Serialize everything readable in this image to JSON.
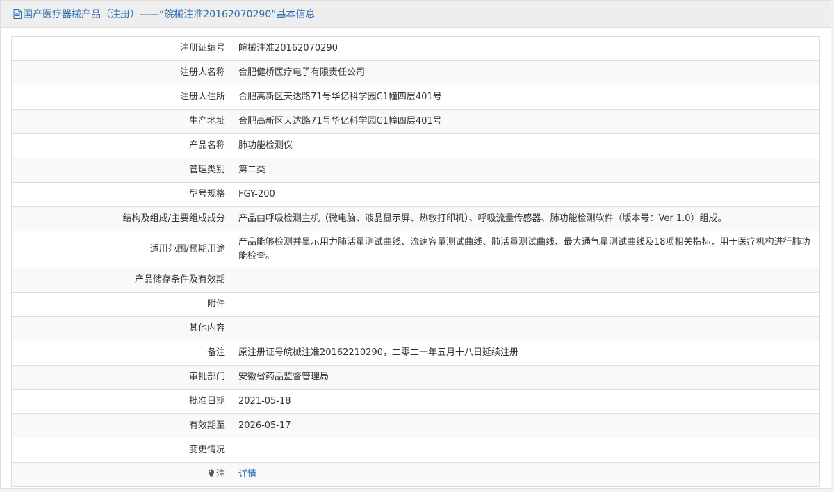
{
  "header": {
    "title": "国产医疗器械产品（注册）——“皖械注准20162070290”基本信息"
  },
  "rows": [
    {
      "label": "注册证编号",
      "value": "皖械注准20162070290"
    },
    {
      "label": "注册人名称",
      "value": "合肥健桥医疗电子有限责任公司"
    },
    {
      "label": "注册人住所",
      "value": "合肥高新区天达路71号华亿科学园C1幢四层401号"
    },
    {
      "label": "生产地址",
      "value": "合肥高新区天达路71号华亿科学园C1幢四层401号"
    },
    {
      "label": "产品名称",
      "value": "肺功能检测仪"
    },
    {
      "label": "管理类别",
      "value": "第二类"
    },
    {
      "label": "型号规格",
      "value": "FGY-200"
    },
    {
      "label": "结构及组成/主要组成成分",
      "value": "产品由呼吸检测主机（微电脑、液晶显示屏、热敏打印机）、呼吸流量传感器、肺功能检测软件（版本号：Ver 1.0）组成。"
    },
    {
      "label": "适用范围/预期用途",
      "value": "产品能够检测并显示用力肺活量测试曲线、流速容量测试曲线、肺活量测试曲线、最大通气量测试曲线及18项相关指标，用于医疗机构进行肺功能检查。"
    },
    {
      "label": "产品储存条件及有效期",
      "value": ""
    },
    {
      "label": "附件",
      "value": ""
    },
    {
      "label": "其他内容",
      "value": ""
    },
    {
      "label": "备注",
      "value": "原注册证号皖械注准20162210290，二零二一年五月十八日延续注册"
    },
    {
      "label": "审批部门",
      "value": "安徽省药品监督管理局"
    },
    {
      "label": "批准日期",
      "value": "2021-05-18"
    },
    {
      "label": "有效期至",
      "value": "2026-05-17"
    },
    {
      "label": "变更情况",
      "value": ""
    }
  ],
  "note": {
    "label": "注",
    "link_text": "详情"
  },
  "colors": {
    "accent": "#2a6cb0",
    "border": "#dddddd",
    "header_bg": "#eeeeee"
  },
  "icons": {
    "header": "document-icon",
    "note": "lightbulb-icon"
  }
}
